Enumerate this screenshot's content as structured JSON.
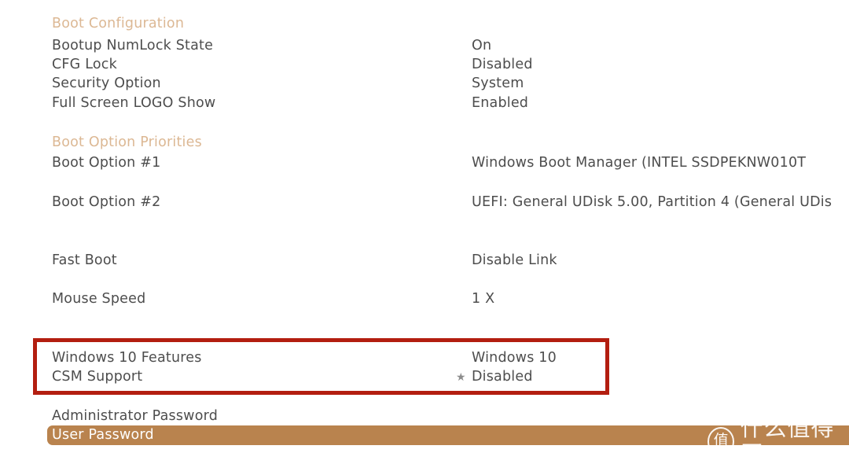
{
  "screen": {
    "background_color": "#ffffff",
    "text_color": "#4d4d4d",
    "section_header_color": "#dcb894",
    "highlight_color": "#b9834e",
    "annotation_box_color": "#b31e10"
  },
  "sections": [
    {
      "title": "Boot Configuration",
      "rows": [
        {
          "label": "Bootup NumLock State",
          "value": "On"
        },
        {
          "label": "CFG Lock",
          "value": "Disabled"
        },
        {
          "label": "Security Option",
          "value": "System"
        },
        {
          "label": "Full Screen LOGO Show",
          "value": "Enabled"
        }
      ]
    },
    {
      "title": "Boot Option Priorities",
      "rows": [
        {
          "label": "Boot Option #1",
          "value": "Windows Boot Manager (INTEL SSDPEKNW010T"
        },
        {
          "label": "Boot Option #2",
          "value": "UEFI: General UDisk 5.00, Partition 4 (General UDis"
        }
      ]
    }
  ],
  "standalone_rows": [
    {
      "label": "Fast Boot",
      "value": "Disable Link"
    },
    {
      "label": "Mouse Speed",
      "value": "1 X"
    }
  ],
  "highlighted_group": {
    "rows": [
      {
        "label": "Windows 10 Features",
        "value": "Windows 10",
        "marker": ""
      },
      {
        "label": "CSM Support",
        "value": "Disabled",
        "marker": "★"
      }
    ]
  },
  "password_rows": [
    {
      "label": "Administrator Password",
      "selected": false
    },
    {
      "label": "User Password",
      "selected": true
    }
  ],
  "watermark": {
    "logo_glyph": "值",
    "text": "什么值得买"
  }
}
